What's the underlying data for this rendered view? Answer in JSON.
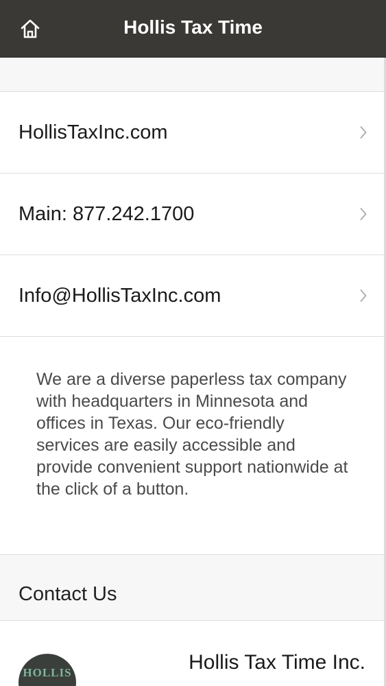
{
  "header": {
    "title": "Hollis Tax Time",
    "home_icon": "home-icon"
  },
  "links": [
    {
      "label": "HollisTaxInc.com",
      "icon": "chevron-right-icon"
    },
    {
      "label": "Main: 877.242.1700",
      "icon": "chevron-right-icon"
    },
    {
      "label": "Info@HollisTaxInc.com",
      "icon": "chevron-right-icon"
    }
  ],
  "about": {
    "text": "We are a diverse paperless tax company with headquarters in Minnesota and offices in Texas. Our eco-friendly services are easily accessible and provide convenient support nationwide at the click of a button."
  },
  "contact": {
    "title": "Contact Us"
  },
  "company": {
    "logo_text": "HOLLIS",
    "name": "Hollis Tax Time Inc."
  },
  "colors": {
    "header_bg": "#3b3936",
    "header_text": "#ffffff",
    "divider": "#dddddd",
    "band_bg": "#f7f7f7",
    "logo_bg": "#3a3f3c",
    "logo_text": "#7fb59a"
  }
}
